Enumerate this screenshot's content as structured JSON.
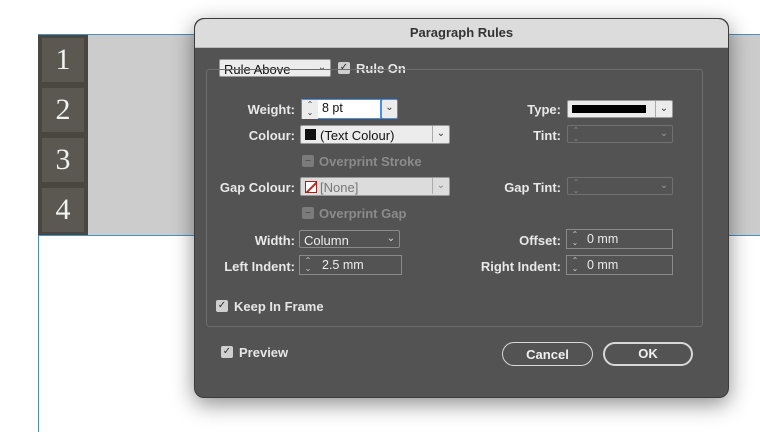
{
  "document": {
    "line_numbers": [
      "1",
      "2",
      "3",
      "4"
    ]
  },
  "dialog": {
    "title": "Paragraph Rules",
    "rule_selector": {
      "value": "Rule Above"
    },
    "rule_on": {
      "label": "Rule On",
      "checked": true
    },
    "weight": {
      "label": "Weight:",
      "value": "8 pt"
    },
    "type": {
      "label": "Type:"
    },
    "colour": {
      "label": "Colour:",
      "value": "(Text Colour)"
    },
    "tint": {
      "label": "Tint:"
    },
    "overprint_stroke": {
      "label": "Overprint Stroke",
      "enabled": false
    },
    "gap_colour": {
      "label": "Gap Colour:",
      "value": "[None]"
    },
    "gap_tint": {
      "label": "Gap Tint:"
    },
    "overprint_gap": {
      "label": "Overprint Gap",
      "enabled": false
    },
    "width": {
      "label": "Width:",
      "value": "Column"
    },
    "offset": {
      "label": "Offset:",
      "value": "0 mm"
    },
    "left_indent": {
      "label": "Left Indent:",
      "value": "2.5 mm"
    },
    "right_indent": {
      "label": "Right Indent:",
      "value": "0 mm"
    },
    "keep_in_frame": {
      "label": "Keep In Frame",
      "checked": true
    },
    "preview": {
      "label": "Preview",
      "checked": true
    },
    "cancel_label": "Cancel",
    "ok_label": "OK"
  },
  "colors": {
    "dialog_bg": "#535353",
    "titlebar_bg": "#dcdcdc",
    "guide_line": "#4a90c2",
    "number_column": "#494740"
  },
  "icons": {
    "chevron": "chevron-down-icon",
    "stepper": "stepper-icon",
    "check": "checkmark-icon",
    "swatch_black": "black-swatch-icon",
    "swatch_none": "none-swatch-icon"
  }
}
